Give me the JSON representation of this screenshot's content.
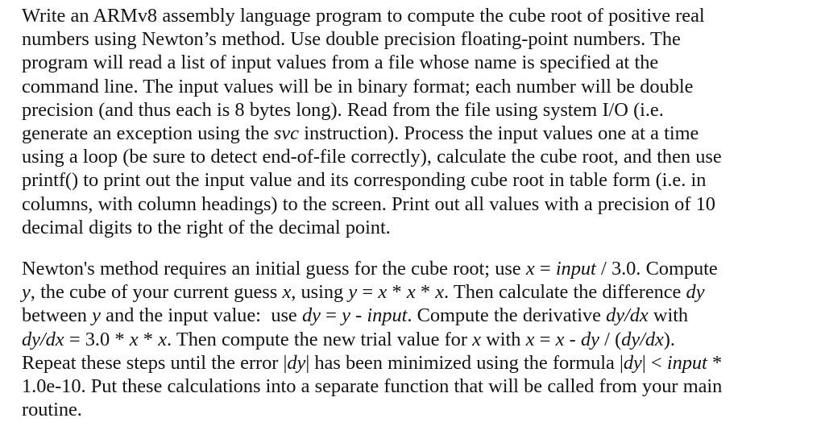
{
  "document": {
    "background_color": "#ffffff",
    "text_color": "#141414",
    "paragraphs": [
      {
        "id": "assignment-description",
        "full_text": "Write an ARMv8 assembly language program to compute the cube root of positive real numbers using Newton’s method. Use double precision floating-point numbers. The program will read a list of input values from a file whose name is specified at the command line. The input values will be in binary format; each number will be double precision (and thus each is 8 bytes long). Read from the file using system I/O (i.e. generate an exception using the svc instruction). Process the input values one at a time using a loop (be sure to detect end-of-file correctly), calculate the cube root, and then use printf() to print out the input value and its corresponding cube root in table form (i.e. in columns, with column headings) to the screen. Print out all values with a precision of 10 decimal digits to the right of the decimal point.",
        "lines": [
          [
            {
              "t": "Write an ARMv8 assembly language program to compute the cube root of positive real",
              "s": "roman"
            }
          ],
          [
            {
              "t": "numbers using Newton’s method. Use double precision floating-point numbers. The",
              "s": "roman"
            }
          ],
          [
            {
              "t": "program will read a list of input values from a file whose name is specified at the",
              "s": "roman"
            }
          ],
          [
            {
              "t": "command line. The input values will be in binary format; each number will be double",
              "s": "roman"
            }
          ],
          [
            {
              "t": "precision (and thus each is 8 bytes long). Read from the file using system I/O (i.e.",
              "s": "roman"
            }
          ],
          [
            {
              "t": "generate an exception using the ",
              "s": "roman"
            },
            {
              "t": "svc",
              "s": "italic"
            },
            {
              "t": " instruction). Process the input values one at a time",
              "s": "roman"
            }
          ],
          [
            {
              "t": "using a loop (be sure to detect end-of-file correctly), calculate the cube root, and then use",
              "s": "roman"
            }
          ],
          [
            {
              "t": "printf() to print out the input value and its corresponding cube root in table form (i.e. in",
              "s": "roman"
            }
          ],
          [
            {
              "t": "columns, with column headings) to the screen. Print out all values with a precision of 10",
              "s": "roman"
            }
          ],
          [
            {
              "t": "decimal digits to the right of the decimal point.",
              "s": "roman"
            }
          ]
        ]
      },
      {
        "id": "newton-method-description",
        "full_text": "Newton's method requires an initial guess for the cube root; use x = input / 3.0. Compute y, the cube of your current guess x, using y = x * x * x. Then calculate the difference dy between y and the input value:  use dy = y - input. Compute the derivative dy/dx with dy/dx = 3.0 * x * x. Then compute the new trial value for x with x = x - dy / (dy/dx). Repeat these steps until the error |dy| has been minimized using the formula |dy| < input * 1.0e-10. Put these calculations into a separate function that will be called from your main routine.",
        "lines": [
          [
            {
              "t": "Newton's method requires an initial guess for the cube root; use ",
              "s": "roman"
            },
            {
              "t": "x",
              "s": "italic"
            },
            {
              "t": " = ",
              "s": "roman"
            },
            {
              "t": "input",
              "s": "italic"
            },
            {
              "t": " / 3.0. Compute",
              "s": "roman"
            }
          ],
          [
            {
              "t": "y",
              "s": "italic"
            },
            {
              "t": ", the cube of your current guess ",
              "s": "roman"
            },
            {
              "t": "x",
              "s": "italic"
            },
            {
              "t": ", using ",
              "s": "roman"
            },
            {
              "t": "y",
              "s": "italic"
            },
            {
              "t": " = ",
              "s": "roman"
            },
            {
              "t": "x",
              "s": "italic"
            },
            {
              "t": " * ",
              "s": "roman"
            },
            {
              "t": "x",
              "s": "italic"
            },
            {
              "t": " * ",
              "s": "roman"
            },
            {
              "t": "x",
              "s": "italic"
            },
            {
              "t": ". Then calculate the difference ",
              "s": "roman"
            },
            {
              "t": "dy",
              "s": "italic"
            }
          ],
          [
            {
              "t": "between ",
              "s": "roman"
            },
            {
              "t": "y",
              "s": "italic"
            },
            {
              "t": " and the input value:  use ",
              "s": "roman"
            },
            {
              "t": "dy",
              "s": "italic"
            },
            {
              "t": " = ",
              "s": "roman"
            },
            {
              "t": "y",
              "s": "italic"
            },
            {
              "t": " - ",
              "s": "roman"
            },
            {
              "t": "input",
              "s": "italic"
            },
            {
              "t": ". Compute the derivative ",
              "s": "roman"
            },
            {
              "t": "dy/dx",
              "s": "italic"
            },
            {
              "t": " with",
              "s": "roman"
            }
          ],
          [
            {
              "t": "dy/dx",
              "s": "italic"
            },
            {
              "t": " = 3.0 * ",
              "s": "roman"
            },
            {
              "t": "x",
              "s": "italic"
            },
            {
              "t": " * ",
              "s": "roman"
            },
            {
              "t": "x",
              "s": "italic"
            },
            {
              "t": ". Then compute the new trial value for ",
              "s": "roman"
            },
            {
              "t": "x",
              "s": "italic"
            },
            {
              "t": " with ",
              "s": "roman"
            },
            {
              "t": "x",
              "s": "italic"
            },
            {
              "t": " = ",
              "s": "roman"
            },
            {
              "t": "x",
              "s": "italic"
            },
            {
              "t": " - ",
              "s": "roman"
            },
            {
              "t": "dy",
              "s": "italic"
            },
            {
              "t": " / (",
              "s": "roman"
            },
            {
              "t": "dy/dx",
              "s": "italic"
            },
            {
              "t": ").",
              "s": "roman"
            }
          ],
          [
            {
              "t": "Repeat these steps until the error |",
              "s": "roman"
            },
            {
              "t": "dy",
              "s": "italic"
            },
            {
              "t": "| has been minimized using the formula |",
              "s": "roman"
            },
            {
              "t": "dy",
              "s": "italic"
            },
            {
              "t": "| < ",
              "s": "roman"
            },
            {
              "t": "input",
              "s": "italic"
            },
            {
              "t": " *",
              "s": "roman"
            }
          ],
          [
            {
              "t": "1.0e-10. Put these calculations into a separate function that will be called from your main",
              "s": "roman"
            }
          ],
          [
            {
              "t": "routine.",
              "s": "roman"
            }
          ]
        ]
      }
    ]
  }
}
